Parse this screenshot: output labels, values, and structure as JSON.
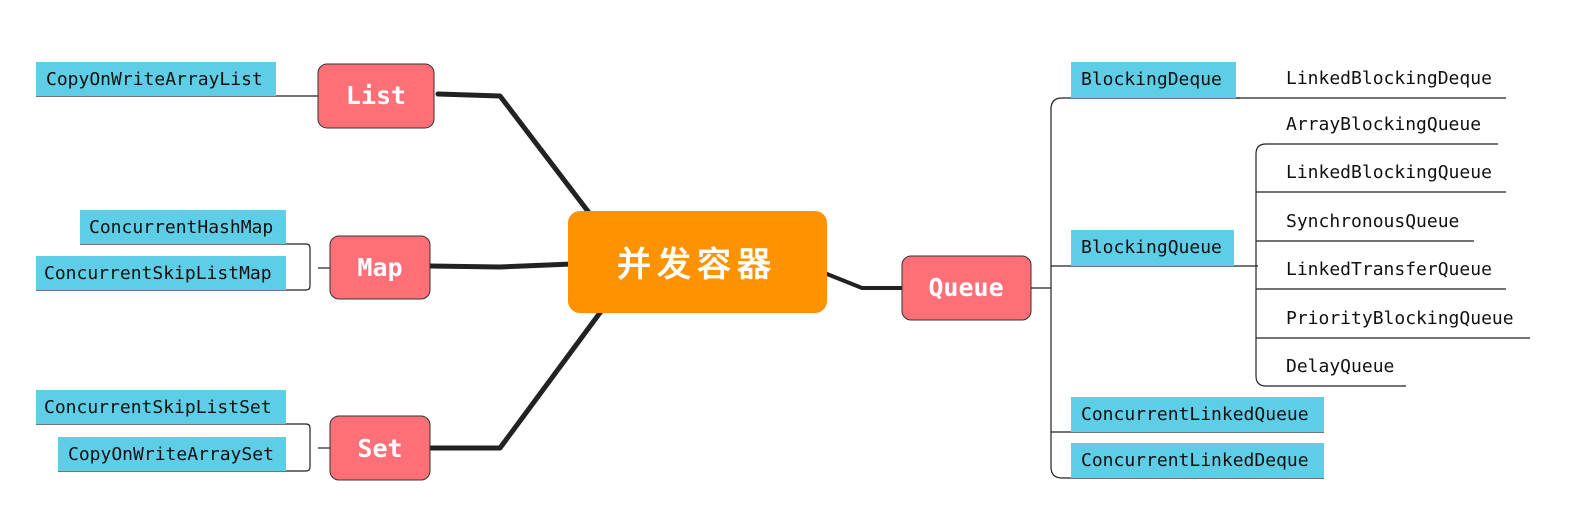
{
  "colors": {
    "root_fill": "#FF9200",
    "branch_fill": "#FF6F78",
    "leaf_fill": "#5ECDE6",
    "line": "#222222",
    "text_light": "#ffffff",
    "text_dark": "#111111"
  },
  "root": {
    "label": "并发容器"
  },
  "branches": {
    "list": {
      "label": "List",
      "items": [
        "CopyOnWriteArrayList"
      ]
    },
    "map": {
      "label": "Map",
      "items": [
        "ConcurrentHashMap",
        "ConcurrentSkipListMap"
      ]
    },
    "set": {
      "label": "Set",
      "items": [
        "ConcurrentSkipListSet",
        "CopyOnWriteArraySet"
      ]
    },
    "queue": {
      "label": "Queue",
      "blocking_deque": {
        "label": "BlockingDeque",
        "items": [
          "LinkedBlockingDeque"
        ]
      },
      "blocking_queue": {
        "label": "BlockingQueue",
        "items": [
          "ArrayBlockingQueue",
          "LinkedBlockingQueue",
          "SynchronousQueue",
          "LinkedTransferQueue",
          "PriorityBlockingQueue",
          "DelayQueue"
        ]
      },
      "concurrent_linked_queue": {
        "label": "ConcurrentLinkedQueue"
      },
      "concurrent_linked_deque": {
        "label": "ConcurrentLinkedDeque"
      }
    }
  }
}
